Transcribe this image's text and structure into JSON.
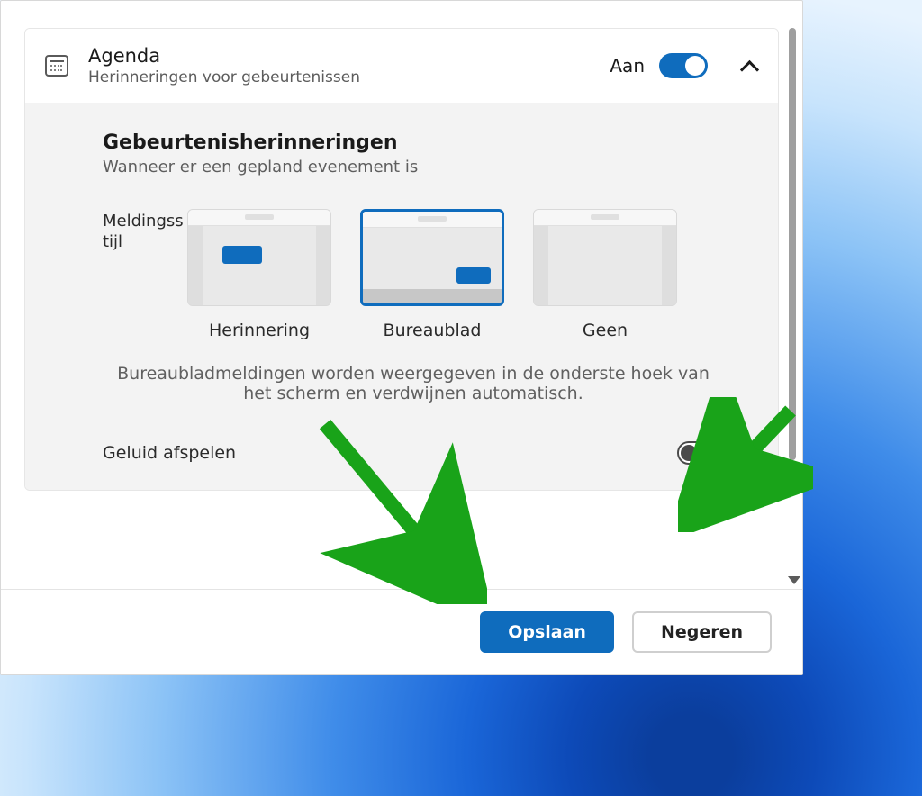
{
  "section": {
    "title": "Agenda",
    "subtitle": "Herinneringen voor gebeurtenissen",
    "status": "Aan"
  },
  "body": {
    "title": "Gebeurtenisherinneringen",
    "subtitle": "Wanneer er een gepland evenement is",
    "style_label": "Meldingsstijl",
    "options": {
      "reminder": "Herinnering",
      "desktop": "Bureaublad",
      "none": "Geen"
    },
    "helper": "Bureaubladmeldingen worden weergegeven in de onderste hoek van het scherm en verdwijnen automatisch.",
    "sound_label": "Geluid afspelen"
  },
  "footer": {
    "save": "Opslaan",
    "ignore": "Negeren"
  }
}
